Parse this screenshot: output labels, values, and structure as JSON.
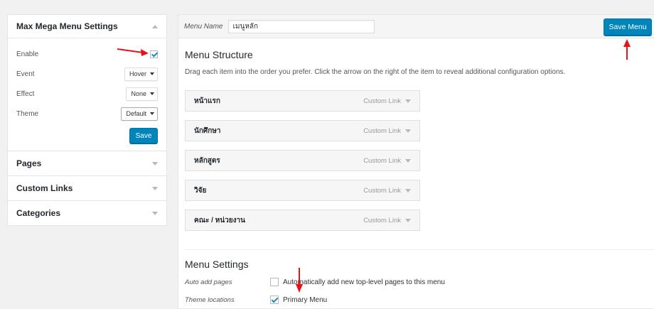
{
  "left_panel": {
    "mega_menu": {
      "title": "Max Mega Menu Settings",
      "enable_label": "Enable",
      "enable_checked": true,
      "event_label": "Event",
      "event_value": "Hover",
      "effect_label": "Effect",
      "effect_value": "None",
      "theme_label": "Theme",
      "theme_value": "Default",
      "save_label": "Save"
    },
    "accordions": [
      {
        "label": "Pages"
      },
      {
        "label": "Custom Links"
      },
      {
        "label": "Categories"
      }
    ]
  },
  "main": {
    "menu_name_label": "Menu Name",
    "menu_name_value": "เมนูหลัก",
    "save_menu_label": "Save Menu",
    "structure_title": "Menu Structure",
    "structure_desc": "Drag each item into the order you prefer. Click the arrow on the right of the item to reveal additional configuration options.",
    "items": [
      {
        "title": "หน้าแรก",
        "type": "Custom Link"
      },
      {
        "title": "นักศึกษา",
        "type": "Custom Link"
      },
      {
        "title": "หลักสูตร",
        "type": "Custom Link"
      },
      {
        "title": "วิจัย",
        "type": "Custom Link"
      },
      {
        "title": "คณะ / หน่วยงาน",
        "type": "Custom Link"
      }
    ],
    "settings_title": "Menu Settings",
    "auto_add_label": "Auto add pages",
    "auto_add_text": "Automatically add new top-level pages to this menu",
    "auto_add_checked": false,
    "theme_locations_label": "Theme locations",
    "primary_menu_text": "Primary Menu",
    "primary_menu_checked": true
  },
  "colors": {
    "accent": "#0085ba",
    "annotation_arrow": "#e5141b"
  }
}
